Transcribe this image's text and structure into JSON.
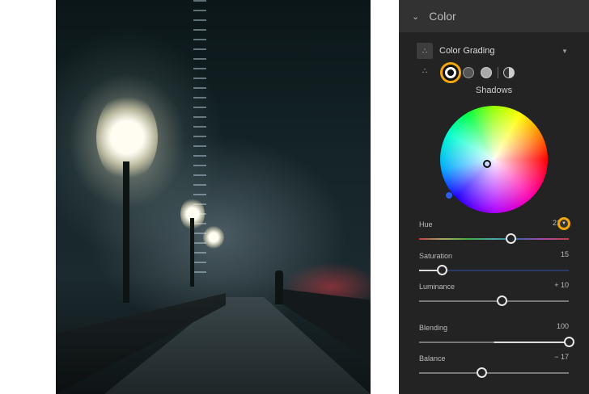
{
  "panel": {
    "section_title": "Color",
    "tool_title": "Color Grading",
    "mode_label": "Shadows",
    "accent": "#f2a60c"
  },
  "sliders": [
    {
      "label": "Hue",
      "value": "219",
      "num": 219,
      "min": 0,
      "max": 359
    },
    {
      "label": "Saturation",
      "value": "15",
      "num": 15,
      "min": 0,
      "max": 100
    },
    {
      "label": "Luminance",
      "value": "+ 10",
      "num": 10,
      "min": -100,
      "max": 100
    },
    {
      "label": "Blending",
      "value": "100",
      "num": 100,
      "min": 0,
      "max": 100
    },
    {
      "label": "Balance",
      "value": "− 17",
      "num": -17,
      "min": -100,
      "max": 100
    }
  ]
}
